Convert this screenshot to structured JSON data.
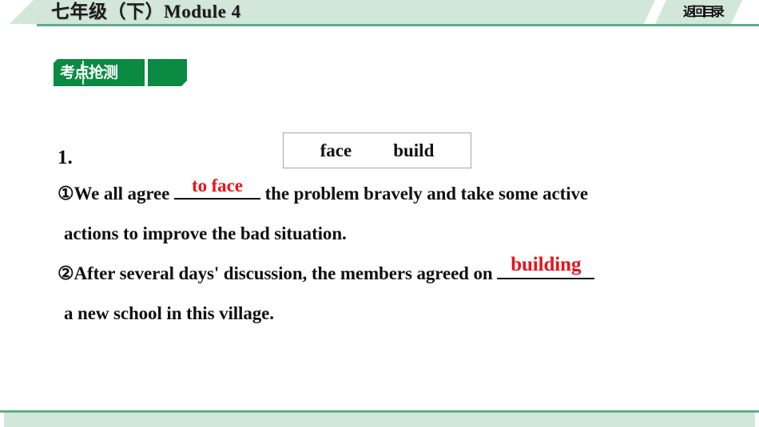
{
  "header": {
    "title": "七年级（下）Module 4",
    "back_label": "返回目录"
  },
  "badge": {
    "label": "考点抢测"
  },
  "wordbank": {
    "words": [
      "face",
      "build"
    ]
  },
  "exercise": {
    "number": "1.",
    "items": [
      {
        "marker": "①",
        "before": "We all agree ",
        "answer": "to face",
        "after": "  the problem bravely and take some active",
        "continuation": "actions to improve the bad situation."
      },
      {
        "marker": "②",
        "before": "After several days' discussion, the members agreed on ",
        "answer": "building",
        "after": "",
        "continuation": "a new school in this village."
      }
    ]
  },
  "colors": {
    "header_band": "#d3e6da",
    "header_rule": "#62ad89",
    "badge_green": "#0a8a42",
    "answer_red": "#e8131b",
    "text_black": "#111111"
  }
}
